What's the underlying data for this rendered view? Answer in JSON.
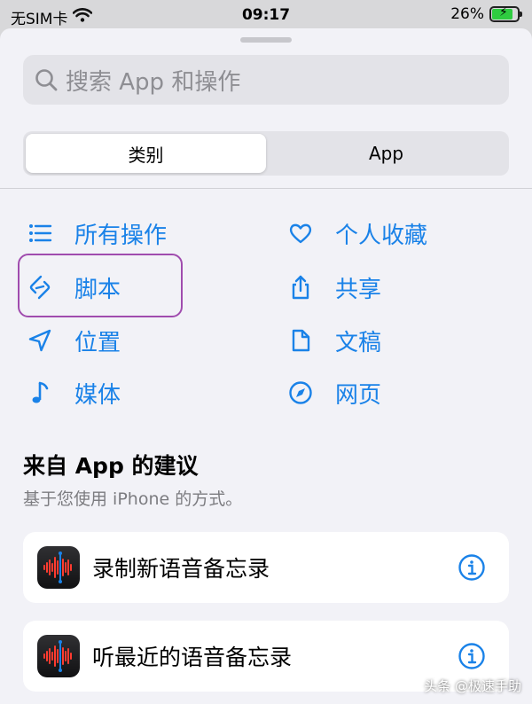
{
  "status_bar": {
    "carrier": "无SIM卡",
    "time": "09:17",
    "battery": "26%",
    "battery_level": 0.26
  },
  "search": {
    "placeholder": "搜索 App 和操作"
  },
  "segments": [
    "类别",
    "App"
  ],
  "categories": {
    "left": [
      {
        "label": "所有操作",
        "icon": "list-icon"
      },
      {
        "label": "脚本",
        "icon": "script-icon"
      },
      {
        "label": "位置",
        "icon": "location-arrow-icon"
      },
      {
        "label": "媒体",
        "icon": "music-note-icon"
      }
    ],
    "right": [
      {
        "label": "个人收藏",
        "icon": "heart-icon"
      },
      {
        "label": "共享",
        "icon": "share-icon"
      },
      {
        "label": "文稿",
        "icon": "document-icon"
      },
      {
        "label": "网页",
        "icon": "compass-icon"
      }
    ]
  },
  "suggestions": {
    "title": "来自 App 的建议",
    "subtitle": "基于您使用 iPhone 的方式。",
    "items": [
      {
        "label": "录制新语音备忘录",
        "icon": "voice-memos-icon"
      },
      {
        "label": "听最近的语音备忘录",
        "icon": "voice-memos-icon"
      }
    ]
  },
  "watermark": "头条 @极速手助",
  "colors": {
    "accent": "#1a82e8",
    "highlight": "#a04cae",
    "background": "#f2f2f7"
  }
}
